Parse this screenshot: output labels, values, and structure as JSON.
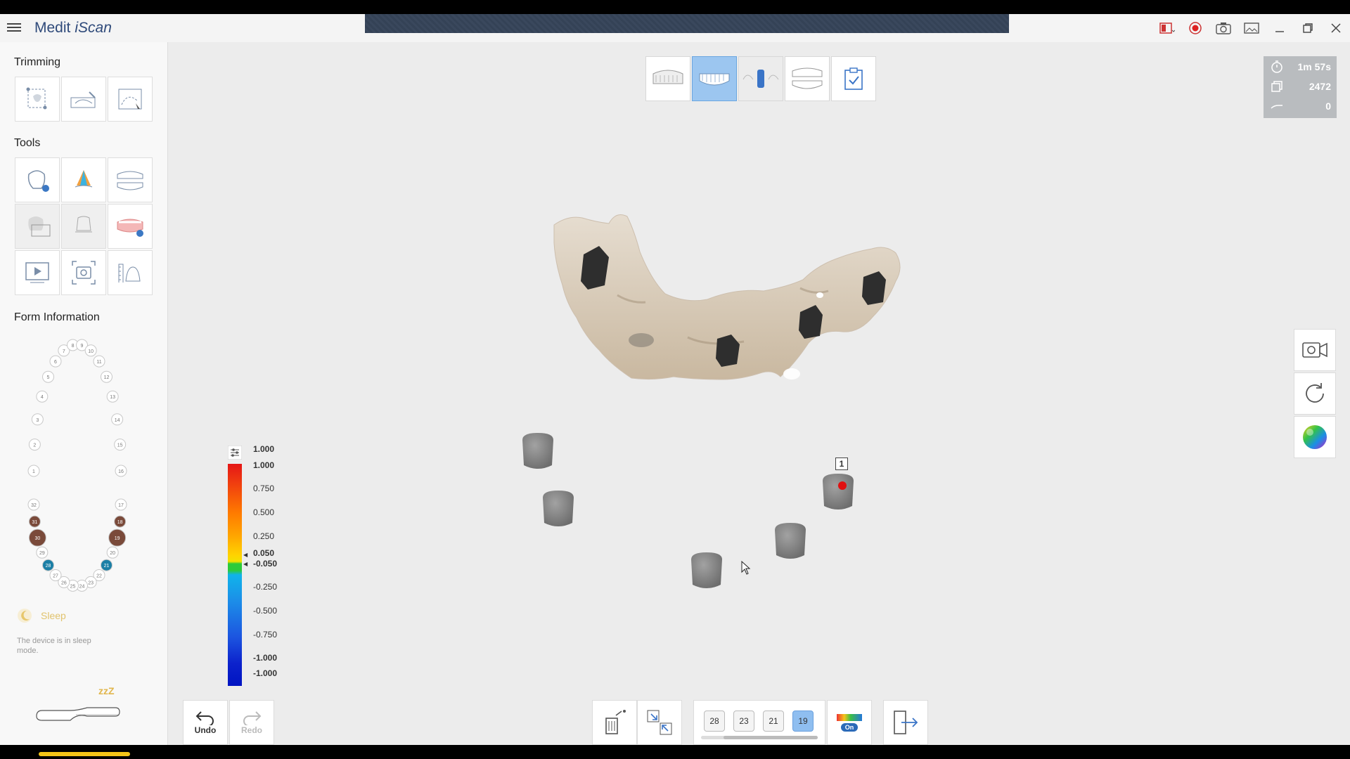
{
  "app": {
    "brand_main": "Medit",
    "brand_sub": "iScan"
  },
  "titlebar": {
    "icons": [
      "screen-record-icon",
      "record-icon",
      "camera-icon",
      "gallery-icon",
      "minimize-icon",
      "restore-icon",
      "close-icon"
    ]
  },
  "sidebar": {
    "trimming_title": "Trimming",
    "tools_title": "Tools",
    "form_title": "Form Information",
    "sleep_label": "Sleep",
    "sleep_note": "The device is in sleep mode.",
    "zzz": "zzZ"
  },
  "stats": {
    "time": "1m 57s",
    "frames": "2472",
    "count": "0"
  },
  "scale": {
    "ticks": [
      "1.000",
      "1.000",
      "0.750",
      "0.500",
      "0.250",
      "0.050",
      "-0.050",
      "-0.250",
      "-0.500",
      "-0.750",
      "-1.000",
      "-1.000"
    ]
  },
  "viewport": {
    "tag": "1"
  },
  "bottom": {
    "undo": "Undo",
    "redo": "Redo",
    "teeth": [
      "28",
      "23",
      "21",
      "19"
    ],
    "selected_tooth": "19",
    "toggle": "On"
  },
  "chart_teeth": {
    "upper": [
      "1",
      "2",
      "3",
      "4",
      "5",
      "6",
      "7",
      "8",
      "9",
      "10",
      "11",
      "12",
      "13",
      "14",
      "15",
      "16"
    ],
    "lower": [
      "17",
      "18",
      "19",
      "20",
      "21",
      "22",
      "23",
      "24",
      "25",
      "26",
      "27",
      "28",
      "29",
      "30",
      "31",
      "32"
    ]
  },
  "colors": {
    "accent": "#9cc6f0",
    "brand": "#2f4a7a",
    "sleep": "#e1c36d"
  }
}
